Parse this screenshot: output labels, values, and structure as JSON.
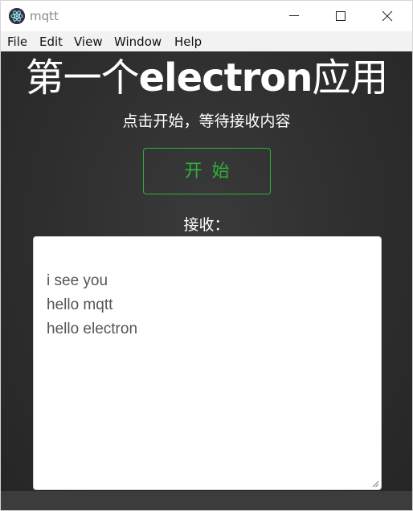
{
  "window": {
    "title": "mqtt",
    "controls": {
      "minimize_icon": "minimize-icon",
      "maximize_icon": "maximize-icon",
      "close_icon": "close-icon"
    }
  },
  "menubar": {
    "items": [
      {
        "label": "File"
      },
      {
        "label": "Edit"
      },
      {
        "label": "View"
      },
      {
        "label": "Window"
      },
      {
        "label": "Help"
      }
    ]
  },
  "main": {
    "heading_cn_prefix": "第一个",
    "heading_en": "electron",
    "heading_cn_suffix": "应用",
    "subtitle": "点击开始，等待接收内容",
    "start_button_label": "开始",
    "receive_label": "接收：",
    "received_lines": [
      "i see you",
      "hello mqtt",
      "hello electron"
    ]
  },
  "colors": {
    "accent_green": "#2db33a",
    "content_bg": "#2e2e2e",
    "text_light": "#ffffff"
  }
}
